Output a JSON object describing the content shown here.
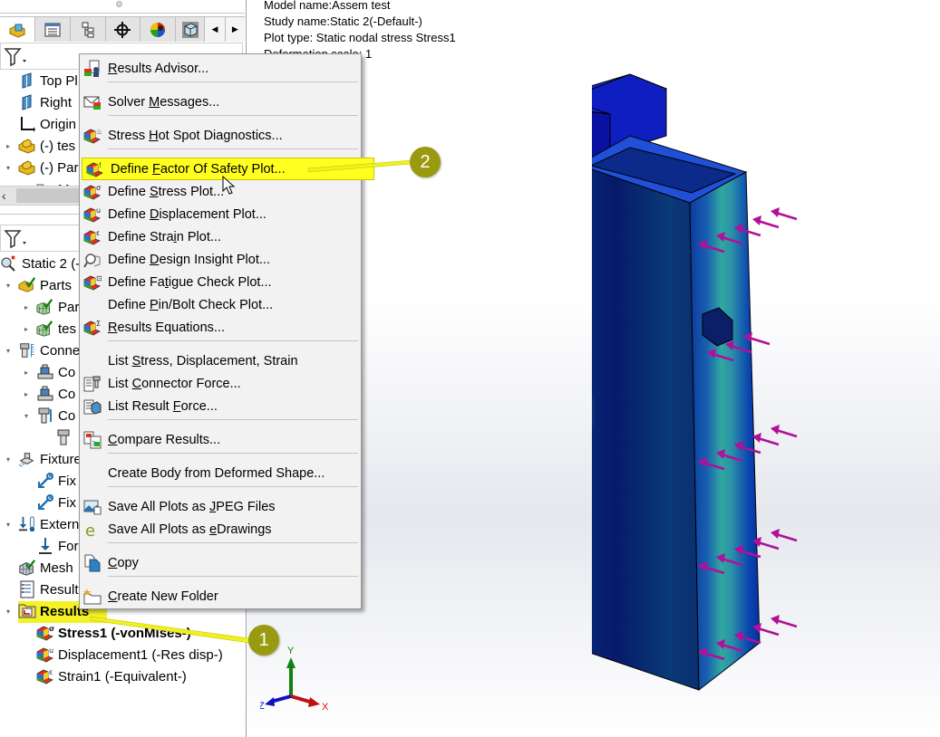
{
  "left_panel": {
    "tabs": [
      {
        "name": "feature-manager",
        "icon": "part-icon",
        "active": true
      },
      {
        "name": "property-manager",
        "icon": "property-list-icon",
        "active": false
      },
      {
        "name": "configuration-manager",
        "icon": "configuration-tree-icon",
        "active": false
      },
      {
        "name": "dimxpert-manager",
        "icon": "crosshair-icon",
        "active": false
      },
      {
        "name": "display-manager",
        "icon": "appearance-ball-icon",
        "active": false
      },
      {
        "name": "simulation",
        "icon": "simulation-cube-icon",
        "active": false
      }
    ],
    "feature_tree": [
      {
        "label": "Top Pl",
        "icon": "plane-icon",
        "expander": ""
      },
      {
        "label": "Right",
        "icon": "plane-icon",
        "expander": ""
      },
      {
        "label": "Origin",
        "icon": "origin-icon",
        "expander": ""
      },
      {
        "label": "(-) tes",
        "icon": "part-icon",
        "expander": "▸"
      },
      {
        "label": "(-) Par",
        "icon": "part-icon",
        "expander": "▾"
      },
      {
        "label": "M",
        "icon": "folder-icon",
        "expander": "▸"
      }
    ],
    "study_tree": [
      {
        "label": "Static 2 (-",
        "icon": "static-study-icon",
        "expander": "",
        "indent": 0
      },
      {
        "label": "Parts",
        "icon": "parts-folder-icon",
        "expander": "▾",
        "indent": 1
      },
      {
        "label": "Par",
        "icon": "meshed-part-icon",
        "expander": "▸",
        "indent": 2
      },
      {
        "label": "tes",
        "icon": "meshed-part-icon",
        "expander": "▸",
        "indent": 2
      },
      {
        "label": "Conne",
        "icon": "connections-icon",
        "expander": "▾",
        "indent": 1
      },
      {
        "label": "Co",
        "icon": "contact-set-icon",
        "expander": "▸",
        "indent": 2
      },
      {
        "label": "Co",
        "icon": "contact-set-icon",
        "expander": "▸",
        "indent": 2
      },
      {
        "label": "Co",
        "icon": "bolt-connector-icon",
        "expander": "▾",
        "indent": 2
      },
      {
        "label": "",
        "icon": "bolt-icon",
        "expander": "",
        "indent": 3
      },
      {
        "label": "Fixture",
        "icon": "fixtures-icon",
        "expander": "▾",
        "indent": 1
      },
      {
        "label": "Fix",
        "icon": "fixed-geometry-icon",
        "expander": "",
        "indent": 2
      },
      {
        "label": "Fix",
        "icon": "fixed-geometry-icon",
        "expander": "",
        "indent": 2
      },
      {
        "label": "Extern",
        "icon": "external-loads-icon",
        "expander": "▾",
        "indent": 1
      },
      {
        "label": "For",
        "icon": "force-icon",
        "expander": "",
        "indent": 2
      },
      {
        "label": "Mesh",
        "icon": "mesh-icon",
        "expander": "",
        "indent": 1
      },
      {
        "label": "Result",
        "icon": "result-options-icon",
        "expander": "",
        "indent": 1
      },
      {
        "label": "Results",
        "icon": "results-folder-icon",
        "expander": "▾",
        "indent": 1,
        "bold": true,
        "highlighted": true
      },
      {
        "label": "Stress1 (-vonMises-)",
        "icon": "stress-plot-icon",
        "expander": "",
        "indent": 2,
        "bold": true
      },
      {
        "label": "Displacement1 (-Res disp-)",
        "icon": "displacement-plot-icon",
        "expander": "",
        "indent": 2
      },
      {
        "label": "Strain1 (-Equivalent-)",
        "icon": "strain-plot-icon",
        "expander": "",
        "indent": 2
      }
    ]
  },
  "viewport": {
    "info": [
      "Model name:Assem test",
      "Study name:Static 2(-Default-)",
      "Plot type: Static nodal stress Stress1",
      "Deformation scale: 1"
    ],
    "triad": {
      "x": "X",
      "y": "Y",
      "z": "Z"
    },
    "colors": {
      "x_axis": "#d01010",
      "y_axis": "#108010",
      "z_axis": "#1010d0",
      "load_arrows": "#b0109a",
      "fixtures": "#10a010"
    }
  },
  "context_menu": {
    "items": [
      {
        "pre": "",
        "u": "R",
        "post": "esults Advisor...",
        "icon": "results-advisor-icon"
      },
      {
        "pre": "Solver ",
        "u": "M",
        "post": "essages...",
        "icon": "solver-messages-icon"
      },
      {
        "pre": "Stress ",
        "u": "H",
        "post": "ot Spot Diagnostics...",
        "icon": "hot-spot-icon"
      },
      {
        "pre": "Define ",
        "u": "F",
        "post": "actor Of Safety Plot...",
        "icon": "factor-of-safety-icon",
        "highlighted": true
      },
      {
        "pre": "Define ",
        "u": "S",
        "post": "tress Plot...",
        "icon": "stress-plot-icon"
      },
      {
        "pre": "Define ",
        "u": "D",
        "post": "isplacement Plot...",
        "icon": "displacement-plot-icon"
      },
      {
        "pre": "Define Stra",
        "u": "i",
        "post": "n Plot...",
        "icon": "strain-plot-icon"
      },
      {
        "pre": "Define ",
        "u": "D",
        "post": "esign Insight Plot...",
        "icon": "design-insight-icon"
      },
      {
        "pre": "Define Fa",
        "u": "t",
        "post": "igue Check Plot...",
        "icon": "fatigue-check-icon"
      },
      {
        "pre": "Define ",
        "u": "P",
        "post": "in/Bolt Check Plot...",
        "icon": ""
      },
      {
        "pre": "",
        "u": "R",
        "post": "esults Equations...",
        "icon": "results-equations-icon"
      },
      {
        "pre": "List ",
        "u": "S",
        "post": "tress, Displacement, Strain",
        "icon": ""
      },
      {
        "pre": "List ",
        "u": "C",
        "post": "onnector Force...",
        "icon": "connector-force-icon"
      },
      {
        "pre": "List Result ",
        "u": "F",
        "post": "orce...",
        "icon": "result-force-icon"
      },
      {
        "pre": "",
        "u": "C",
        "post": "ompare Results...",
        "icon": "compare-results-icon"
      },
      {
        "pre": "Create Body from Deformed Shape...",
        "u": "",
        "post": "",
        "icon": ""
      },
      {
        "pre": "Save All Plots as ",
        "u": "J",
        "post": "PEG Files",
        "icon": "jpeg-image-icon"
      },
      {
        "pre": "Save All Plots as ",
        "u": "e",
        "post": "Drawings",
        "icon": "edrawings-icon"
      },
      {
        "pre": "",
        "u": "C",
        "post": "opy",
        "icon": "copy-icon"
      },
      {
        "pre": "",
        "u": "C",
        "post": "reate New Folder",
        "icon": "new-folder-icon"
      }
    ]
  },
  "callouts": [
    {
      "number": "1",
      "target": "Results"
    },
    {
      "number": "2",
      "target": "Define Factor Of Safety Plot..."
    }
  ],
  "theme": {
    "highlight": "#ffff20",
    "callout_fill": "#9a9a10",
    "menu_bg": "#f2f2f2"
  }
}
